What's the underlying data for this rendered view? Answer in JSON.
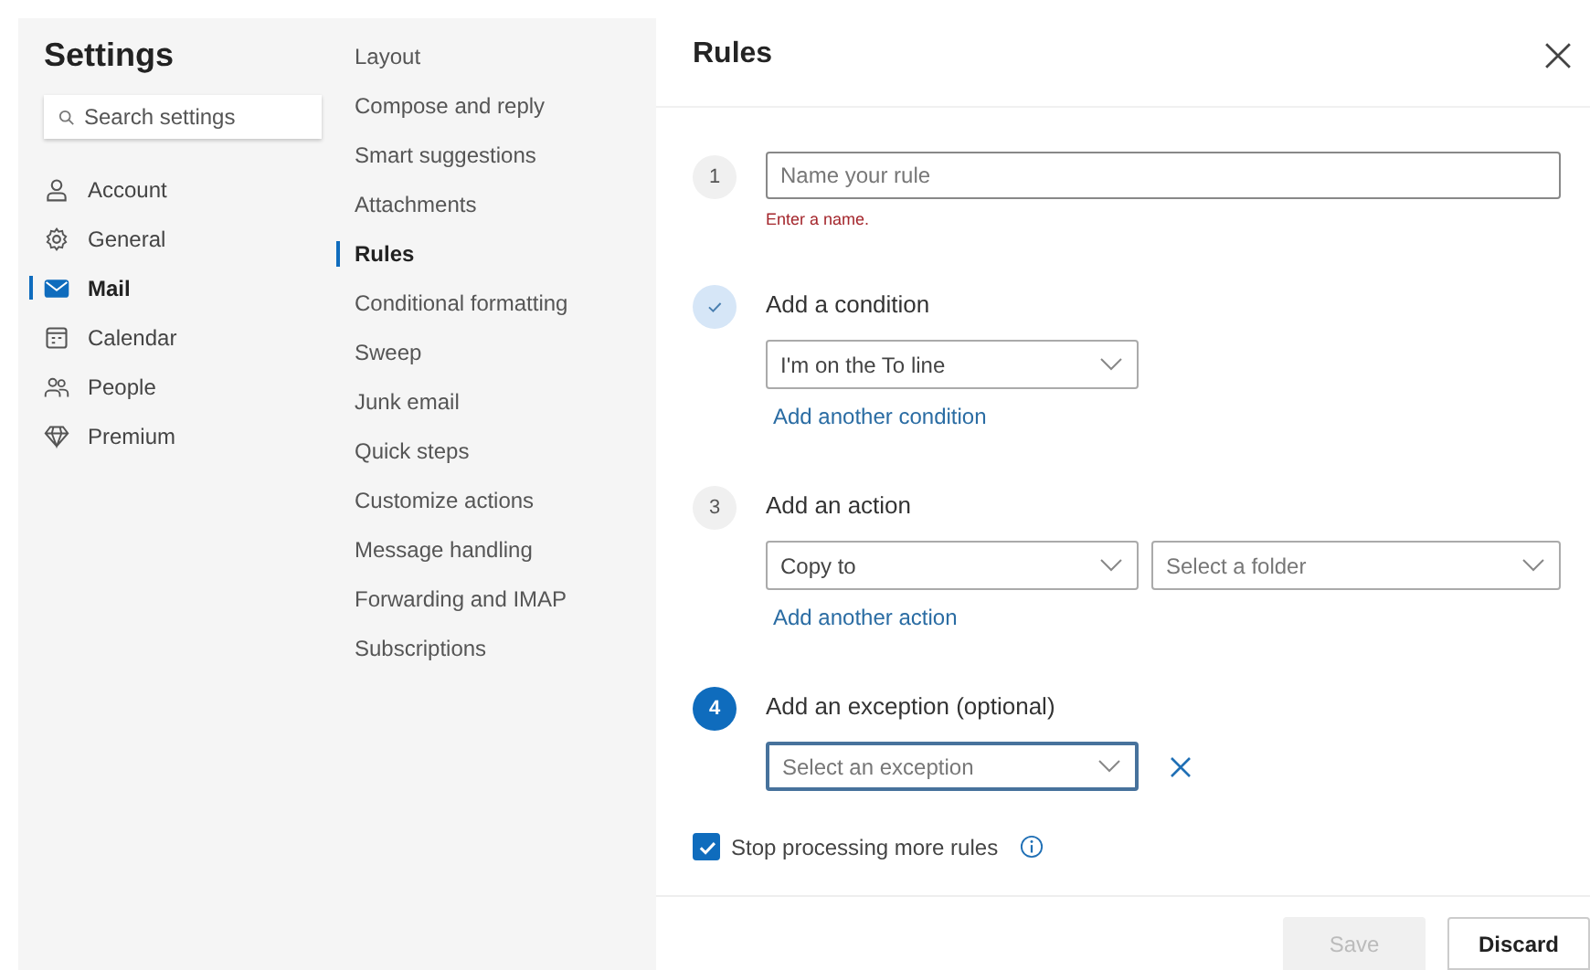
{
  "sidebar": {
    "title": "Settings",
    "search": {
      "placeholder": "Search settings"
    },
    "items": [
      {
        "label": "Account",
        "selected": false
      },
      {
        "label": "General",
        "selected": false
      },
      {
        "label": "Mail",
        "selected": true
      },
      {
        "label": "Calendar",
        "selected": false
      },
      {
        "label": "People",
        "selected": false
      },
      {
        "label": "Premium",
        "selected": false
      }
    ]
  },
  "subnav": {
    "items": [
      {
        "label": "Layout",
        "selected": false
      },
      {
        "label": "Compose and reply",
        "selected": false
      },
      {
        "label": "Smart suggestions",
        "selected": false
      },
      {
        "label": "Attachments",
        "selected": false
      },
      {
        "label": "Rules",
        "selected": true
      },
      {
        "label": "Conditional formatting",
        "selected": false
      },
      {
        "label": "Sweep",
        "selected": false
      },
      {
        "label": "Junk email",
        "selected": false
      },
      {
        "label": "Quick steps",
        "selected": false
      },
      {
        "label": "Customize actions",
        "selected": false
      },
      {
        "label": "Message handling",
        "selected": false
      },
      {
        "label": "Forwarding and IMAP",
        "selected": false
      },
      {
        "label": "Subscriptions",
        "selected": false
      }
    ]
  },
  "panel": {
    "title": "Rules",
    "steps": [
      {
        "number": "1",
        "completed": false,
        "active": false,
        "field": {
          "placeholder": "Name your rule"
        },
        "error": "Enter a name."
      },
      {
        "completed": true,
        "active": false,
        "title": "Add a condition",
        "dropdowns": [
          {
            "value": "I'm on the To line",
            "focused": false
          }
        ],
        "link": "Add another condition"
      },
      {
        "number": "3",
        "completed": false,
        "active": false,
        "title": "Add an action",
        "dropdowns": [
          {
            "value": "Copy to",
            "focused": false
          },
          {
            "placeholder": "Select a folder",
            "focused": false
          }
        ],
        "link": "Add another action"
      },
      {
        "number": "4",
        "completed": false,
        "active": true,
        "title": "Add an exception (optional)",
        "dropdowns": [
          {
            "placeholder": "Select an exception",
            "focused": true
          }
        ],
        "removable": true
      }
    ],
    "checkbox": {
      "label": "Stop processing more rules",
      "checked": true
    },
    "buttons": [
      {
        "label": "Save",
        "disabled": true
      },
      {
        "label": "Discard",
        "disabled": false
      }
    ]
  }
}
